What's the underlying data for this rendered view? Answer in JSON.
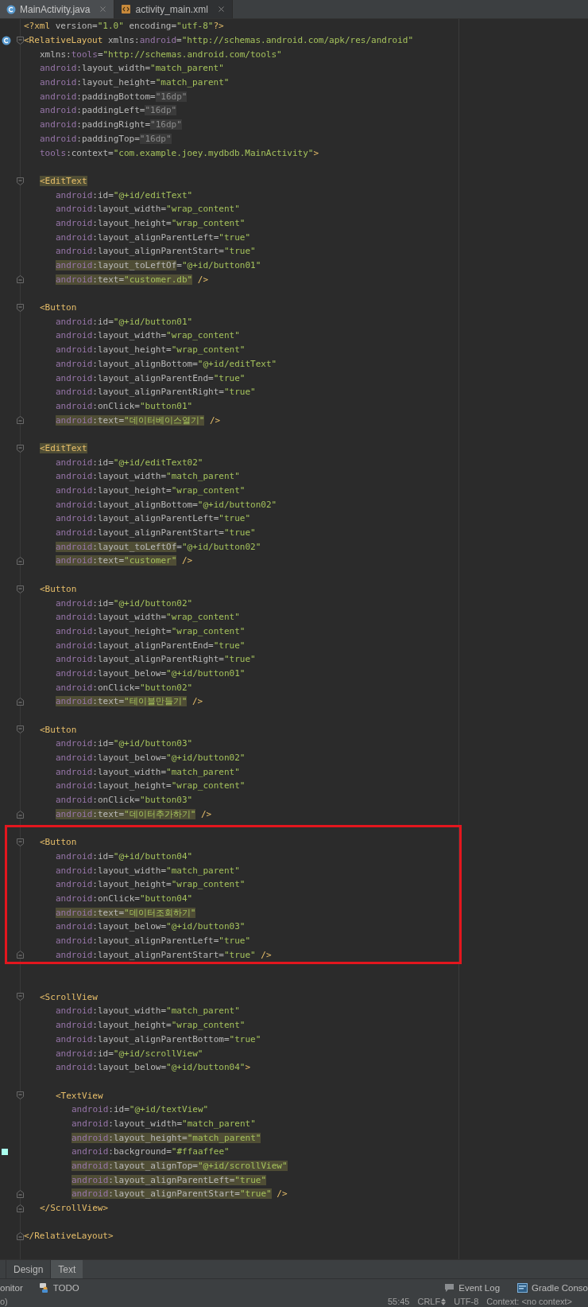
{
  "tabs": [
    {
      "label": "MainActivity.java",
      "kind": "java",
      "selected": false
    },
    {
      "label": "activity_main.xml",
      "kind": "xml",
      "selected": true
    }
  ],
  "code": [
    {
      "kind": "plain",
      "tokens": [
        {
          "t": "<?xml",
          "kind": "tag"
        },
        {
          "t": " version=",
          "kind": "attr"
        },
        {
          "t": "\"1.0\"",
          "kind": "str"
        },
        {
          "t": " encoding=",
          "kind": "attr"
        },
        {
          "t": "\"utf-8\"",
          "kind": "str"
        },
        {
          "t": "?>",
          "kind": "tag"
        }
      ]
    },
    {
      "kind": "class_open",
      "tokens": [
        {
          "t": "<RelativeLayout",
          "kind": "tag"
        },
        {
          "t": " xmlns:",
          "kind": "attr"
        },
        {
          "t": "android",
          "kind": "ns"
        },
        {
          "t": "=",
          "kind": "attr"
        },
        {
          "t": "\"http://schemas.android.com/apk/res/android\"",
          "kind": "str"
        }
      ],
      "children": [
        {
          "kind": "plain",
          "tokens": [
            {
              "t": "xmlns:",
              "kind": "attr"
            },
            {
              "t": "tools",
              "kind": "ns"
            },
            {
              "t": "=",
              "kind": "attr"
            },
            {
              "t": "\"http://schemas.android.com/tools\"",
              "kind": "str"
            }
          ]
        },
        {
          "kind": "plain",
          "tokens": [
            {
              "t": "android",
              "kind": "ns"
            },
            {
              "t": ":layout_width=",
              "kind": "attr"
            },
            {
              "t": "\"match_parent\"",
              "kind": "str"
            }
          ]
        },
        {
          "kind": "plain",
          "tokens": [
            {
              "t": "android",
              "kind": "ns"
            },
            {
              "t": ":layout_height=",
              "kind": "attr"
            },
            {
              "t": "\"match_parent\"",
              "kind": "str"
            }
          ]
        },
        {
          "kind": "plain",
          "tokens": [
            {
              "t": "android",
              "kind": "ns"
            },
            {
              "t": ":paddingBottom=",
              "kind": "attr"
            },
            {
              "t": "\"16dp\"",
              "kind": "dim"
            }
          ]
        },
        {
          "kind": "plain",
          "tokens": [
            {
              "t": "android",
              "kind": "ns"
            },
            {
              "t": ":paddingLeft=",
              "kind": "attr"
            },
            {
              "t": "\"16dp\"",
              "kind": "dim"
            }
          ]
        },
        {
          "kind": "plain",
          "tokens": [
            {
              "t": "android",
              "kind": "ns"
            },
            {
              "t": ":paddingRight=",
              "kind": "attr"
            },
            {
              "t": "\"16dp\"",
              "kind": "dim"
            }
          ]
        },
        {
          "kind": "plain",
          "tokens": [
            {
              "t": "android",
              "kind": "ns"
            },
            {
              "t": ":paddingTop=",
              "kind": "attr"
            },
            {
              "t": "\"16dp\"",
              "kind": "dim"
            }
          ]
        },
        {
          "kind": "plain",
          "tokens": [
            {
              "t": "tools",
              "kind": "ns"
            },
            {
              "t": ":context=",
              "kind": "attr"
            },
            {
              "t": "\"com.example.joey.mydbdb.MainActivity\"",
              "kind": "str"
            },
            {
              "t": ">",
              "kind": "tag"
            }
          ]
        },
        {
          "kind": "blank"
        },
        {
          "kind": "open",
          "tokens": [
            {
              "t": "<EditText",
              "kind": "tag_hl"
            }
          ],
          "children": [
            {
              "kind": "plain",
              "tokens": [
                {
                  "t": "android",
                  "kind": "ns"
                },
                {
                  "t": ":id=",
                  "kind": "attr"
                },
                {
                  "t": "\"@+id/editText\"",
                  "kind": "str"
                }
              ]
            },
            {
              "kind": "plain",
              "tokens": [
                {
                  "t": "android",
                  "kind": "ns"
                },
                {
                  "t": ":layout_width=",
                  "kind": "attr"
                },
                {
                  "t": "\"wrap_content\"",
                  "kind": "str"
                }
              ]
            },
            {
              "kind": "plain",
              "tokens": [
                {
                  "t": "android",
                  "kind": "ns"
                },
                {
                  "t": ":layout_height=",
                  "kind": "attr"
                },
                {
                  "t": "\"wrap_content\"",
                  "kind": "str"
                }
              ]
            },
            {
              "kind": "plain",
              "tokens": [
                {
                  "t": "android",
                  "kind": "ns"
                },
                {
                  "t": ":layout_alignParentLeft=",
                  "kind": "attr"
                },
                {
                  "t": "\"true\"",
                  "kind": "str"
                }
              ]
            },
            {
              "kind": "plain",
              "tokens": [
                {
                  "t": "android",
                  "kind": "ns"
                },
                {
                  "t": ":layout_alignParentStart=",
                  "kind": "attr"
                },
                {
                  "t": "\"true\"",
                  "kind": "str"
                }
              ]
            },
            {
              "kind": "plain",
              "tokens": [
                {
                  "t": "android",
                  "kind": "ns_hl"
                },
                {
                  "t": ":layout_toLeftOf",
                  "kind": "attr_hl"
                },
                {
                  "t": "=",
                  "kind": "attr"
                },
                {
                  "t": "\"@+id/button01\"",
                  "kind": "str"
                }
              ]
            },
            {
              "kind": "close",
              "tokens": [
                {
                  "t": "android",
                  "kind": "ns_hl"
                },
                {
                  "t": ":text=",
                  "kind": "attr_hl"
                },
                {
                  "t": "\"customer.db\"",
                  "kind": "str_hl"
                },
                {
                  "t": " />",
                  "kind": "tag"
                }
              ]
            }
          ]
        },
        {
          "kind": "blank"
        },
        {
          "kind": "open",
          "tokens": [
            {
              "t": "<Button",
              "kind": "tag"
            }
          ],
          "children": [
            {
              "kind": "plain",
              "tokens": [
                {
                  "t": "android",
                  "kind": "ns"
                },
                {
                  "t": ":id=",
                  "kind": "attr"
                },
                {
                  "t": "\"@+id/button01\"",
                  "kind": "str"
                }
              ]
            },
            {
              "kind": "plain",
              "tokens": [
                {
                  "t": "android",
                  "kind": "ns"
                },
                {
                  "t": ":layout_width=",
                  "kind": "attr"
                },
                {
                  "t": "\"wrap_content\"",
                  "kind": "str"
                }
              ]
            },
            {
              "kind": "plain",
              "tokens": [
                {
                  "t": "android",
                  "kind": "ns"
                },
                {
                  "t": ":layout_height=",
                  "kind": "attr"
                },
                {
                  "t": "\"wrap_content\"",
                  "kind": "str"
                }
              ]
            },
            {
              "kind": "plain",
              "tokens": [
                {
                  "t": "android",
                  "kind": "ns"
                },
                {
                  "t": ":layout_alignBottom=",
                  "kind": "attr"
                },
                {
                  "t": "\"@+id/editText\"",
                  "kind": "str"
                }
              ]
            },
            {
              "kind": "plain",
              "tokens": [
                {
                  "t": "android",
                  "kind": "ns"
                },
                {
                  "t": ":layout_alignParentEnd=",
                  "kind": "attr"
                },
                {
                  "t": "\"true\"",
                  "kind": "str"
                }
              ]
            },
            {
              "kind": "plain",
              "tokens": [
                {
                  "t": "android",
                  "kind": "ns"
                },
                {
                  "t": ":layout_alignParentRight=",
                  "kind": "attr"
                },
                {
                  "t": "\"true\"",
                  "kind": "str"
                }
              ]
            },
            {
              "kind": "plain",
              "tokens": [
                {
                  "t": "android",
                  "kind": "ns"
                },
                {
                  "t": ":onClick=",
                  "kind": "attr"
                },
                {
                  "t": "\"button01\"",
                  "kind": "str"
                }
              ]
            },
            {
              "kind": "close",
              "tokens": [
                {
                  "t": "android",
                  "kind": "ns_hl"
                },
                {
                  "t": ":text=",
                  "kind": "attr_hl"
                },
                {
                  "t": "\"데이터베이스열기\"",
                  "kind": "str_hl"
                },
                {
                  "t": " />",
                  "kind": "tag"
                }
              ]
            }
          ]
        },
        {
          "kind": "blank"
        },
        {
          "kind": "open",
          "tokens": [
            {
              "t": "<EditText",
              "kind": "tag_hl"
            }
          ],
          "children": [
            {
              "kind": "plain",
              "tokens": [
                {
                  "t": "android",
                  "kind": "ns"
                },
                {
                  "t": ":id=",
                  "kind": "attr"
                },
                {
                  "t": "\"@+id/editText02\"",
                  "kind": "str"
                }
              ]
            },
            {
              "kind": "plain",
              "tokens": [
                {
                  "t": "android",
                  "kind": "ns"
                },
                {
                  "t": ":layout_width=",
                  "kind": "attr"
                },
                {
                  "t": "\"match_parent\"",
                  "kind": "str"
                }
              ]
            },
            {
              "kind": "plain",
              "tokens": [
                {
                  "t": "android",
                  "kind": "ns"
                },
                {
                  "t": ":layout_height=",
                  "kind": "attr"
                },
                {
                  "t": "\"wrap_content\"",
                  "kind": "str"
                }
              ]
            },
            {
              "kind": "plain",
              "tokens": [
                {
                  "t": "android",
                  "kind": "ns"
                },
                {
                  "t": ":layout_alignBottom=",
                  "kind": "attr"
                },
                {
                  "t": "\"@+id/button02\"",
                  "kind": "str"
                }
              ]
            },
            {
              "kind": "plain",
              "tokens": [
                {
                  "t": "android",
                  "kind": "ns"
                },
                {
                  "t": ":layout_alignParentLeft=",
                  "kind": "attr"
                },
                {
                  "t": "\"true\"",
                  "kind": "str"
                }
              ]
            },
            {
              "kind": "plain",
              "tokens": [
                {
                  "t": "android",
                  "kind": "ns"
                },
                {
                  "t": ":layout_alignParentStart=",
                  "kind": "attr"
                },
                {
                  "t": "\"true\"",
                  "kind": "str"
                }
              ]
            },
            {
              "kind": "plain",
              "tokens": [
                {
                  "t": "android",
                  "kind": "ns_hl"
                },
                {
                  "t": ":layout_toLeftOf",
                  "kind": "attr_hl"
                },
                {
                  "t": "=",
                  "kind": "attr"
                },
                {
                  "t": "\"@+id/button02\"",
                  "kind": "str"
                }
              ]
            },
            {
              "kind": "close",
              "tokens": [
                {
                  "t": "android",
                  "kind": "ns_hl"
                },
                {
                  "t": ":text=",
                  "kind": "attr_hl"
                },
                {
                  "t": "\"customer\"",
                  "kind": "str_hl"
                },
                {
                  "t": " />",
                  "kind": "tag"
                }
              ]
            }
          ]
        },
        {
          "kind": "blank"
        },
        {
          "kind": "open",
          "tokens": [
            {
              "t": "<Button",
              "kind": "tag"
            }
          ],
          "children": [
            {
              "kind": "plain",
              "tokens": [
                {
                  "t": "android",
                  "kind": "ns"
                },
                {
                  "t": ":id=",
                  "kind": "attr"
                },
                {
                  "t": "\"@+id/button02\"",
                  "kind": "str"
                }
              ]
            },
            {
              "kind": "plain",
              "tokens": [
                {
                  "t": "android",
                  "kind": "ns"
                },
                {
                  "t": ":layout_width=",
                  "kind": "attr"
                },
                {
                  "t": "\"wrap_content\"",
                  "kind": "str"
                }
              ]
            },
            {
              "kind": "plain",
              "tokens": [
                {
                  "t": "android",
                  "kind": "ns"
                },
                {
                  "t": ":layout_height=",
                  "kind": "attr"
                },
                {
                  "t": "\"wrap_content\"",
                  "kind": "str"
                }
              ]
            },
            {
              "kind": "plain",
              "tokens": [
                {
                  "t": "android",
                  "kind": "ns"
                },
                {
                  "t": ":layout_alignParentEnd=",
                  "kind": "attr"
                },
                {
                  "t": "\"true\"",
                  "kind": "str"
                }
              ]
            },
            {
              "kind": "plain",
              "tokens": [
                {
                  "t": "android",
                  "kind": "ns"
                },
                {
                  "t": ":layout_alignParentRight=",
                  "kind": "attr"
                },
                {
                  "t": "\"true\"",
                  "kind": "str"
                }
              ]
            },
            {
              "kind": "plain",
              "tokens": [
                {
                  "t": "android",
                  "kind": "ns"
                },
                {
                  "t": ":layout_below=",
                  "kind": "attr"
                },
                {
                  "t": "\"@+id/button01\"",
                  "kind": "str"
                }
              ]
            },
            {
              "kind": "plain",
              "tokens": [
                {
                  "t": "android",
                  "kind": "ns"
                },
                {
                  "t": ":onClick=",
                  "kind": "attr"
                },
                {
                  "t": "\"button02\"",
                  "kind": "str"
                }
              ]
            },
            {
              "kind": "close",
              "tokens": [
                {
                  "t": "android",
                  "kind": "ns_hl"
                },
                {
                  "t": ":text=",
                  "kind": "attr_hl"
                },
                {
                  "t": "\"테이블만들기\"",
                  "kind": "str_hl"
                },
                {
                  "t": " />",
                  "kind": "tag"
                }
              ]
            }
          ]
        },
        {
          "kind": "blank"
        },
        {
          "kind": "open",
          "tokens": [
            {
              "t": "<Button",
              "kind": "tag"
            }
          ],
          "children": [
            {
              "kind": "plain",
              "tokens": [
                {
                  "t": "android",
                  "kind": "ns"
                },
                {
                  "t": ":id=",
                  "kind": "attr"
                },
                {
                  "t": "\"@+id/button03\"",
                  "kind": "str"
                }
              ]
            },
            {
              "kind": "plain",
              "tokens": [
                {
                  "t": "android",
                  "kind": "ns"
                },
                {
                  "t": ":layout_below=",
                  "kind": "attr"
                },
                {
                  "t": "\"@+id/button02\"",
                  "kind": "str"
                }
              ]
            },
            {
              "kind": "plain",
              "tokens": [
                {
                  "t": "android",
                  "kind": "ns"
                },
                {
                  "t": ":layout_width=",
                  "kind": "attr"
                },
                {
                  "t": "\"match_parent\"",
                  "kind": "str"
                }
              ]
            },
            {
              "kind": "plain",
              "tokens": [
                {
                  "t": "android",
                  "kind": "ns"
                },
                {
                  "t": ":layout_height=",
                  "kind": "attr"
                },
                {
                  "t": "\"wrap_content\"",
                  "kind": "str"
                }
              ]
            },
            {
              "kind": "plain",
              "tokens": [
                {
                  "t": "android",
                  "kind": "ns"
                },
                {
                  "t": ":onClick=",
                  "kind": "attr"
                },
                {
                  "t": "\"button03\"",
                  "kind": "str"
                }
              ]
            },
            {
              "kind": "close",
              "tokens": [
                {
                  "t": "android",
                  "kind": "ns_hl"
                },
                {
                  "t": ":text=",
                  "kind": "attr_hl"
                },
                {
                  "t": "\"데이터추가하기\"",
                  "kind": "str_hl"
                },
                {
                  "t": " />",
                  "kind": "tag"
                }
              ]
            }
          ]
        },
        {
          "kind": "blank"
        },
        {
          "kind": "frame",
          "children": [
            {
              "kind": "open",
              "tokens": [
                {
                  "t": "<Button",
                  "kind": "tag"
                }
              ],
              "children": [
                {
                  "kind": "plain",
                  "tokens": [
                    {
                      "t": "android",
                      "kind": "ns"
                    },
                    {
                      "t": ":id=",
                      "kind": "attr"
                    },
                    {
                      "t": "\"@+id/button04\"",
                      "kind": "str"
                    }
                  ]
                },
                {
                  "kind": "plain",
                  "tokens": [
                    {
                      "t": "android",
                      "kind": "ns"
                    },
                    {
                      "t": ":layout_width=",
                      "kind": "attr"
                    },
                    {
                      "t": "\"match_parent\"",
                      "kind": "str"
                    }
                  ]
                },
                {
                  "kind": "plain",
                  "tokens": [
                    {
                      "t": "android",
                      "kind": "ns"
                    },
                    {
                      "t": ":layout_height=",
                      "kind": "attr"
                    },
                    {
                      "t": "\"wrap_content\"",
                      "kind": "str"
                    }
                  ]
                },
                {
                  "kind": "plain",
                  "tokens": [
                    {
                      "t": "android",
                      "kind": "ns"
                    },
                    {
                      "t": ":onClick=",
                      "kind": "attr"
                    },
                    {
                      "t": "\"button04\"",
                      "kind": "str"
                    }
                  ]
                },
                {
                  "kind": "plain",
                  "tokens": [
                    {
                      "t": "android",
                      "kind": "ns_hl"
                    },
                    {
                      "t": ":text=",
                      "kind": "attr_hl"
                    },
                    {
                      "t": "\"데이터조회하기\"",
                      "kind": "str_hl"
                    }
                  ]
                },
                {
                  "kind": "plain",
                  "tokens": [
                    {
                      "t": "android",
                      "kind": "ns"
                    },
                    {
                      "t": ":layout_below=",
                      "kind": "attr"
                    },
                    {
                      "t": "\"@+id/button03\"",
                      "kind": "str"
                    }
                  ]
                },
                {
                  "kind": "plain",
                  "tokens": [
                    {
                      "t": "android",
                      "kind": "ns"
                    },
                    {
                      "t": ":layout_alignParentLeft=",
                      "kind": "attr"
                    },
                    {
                      "t": "\"true\"",
                      "kind": "str"
                    }
                  ]
                },
                {
                  "kind": "close",
                  "tokens": [
                    {
                      "t": "android",
                      "kind": "ns"
                    },
                    {
                      "t": ":layout_alignParentStart=",
                      "kind": "attr"
                    },
                    {
                      "t": "\"true\"",
                      "kind": "str"
                    },
                    {
                      "t": " />",
                      "kind": "tag"
                    }
                  ]
                }
              ]
            }
          ]
        },
        {
          "kind": "blank"
        },
        {
          "kind": "blank"
        },
        {
          "kind": "open",
          "tokens": [
            {
              "t": "<ScrollView",
              "kind": "tag"
            }
          ],
          "children": [
            {
              "kind": "plain",
              "tokens": [
                {
                  "t": "android",
                  "kind": "ns"
                },
                {
                  "t": ":layout_width=",
                  "kind": "attr"
                },
                {
                  "t": "\"match_parent\"",
                  "kind": "str"
                }
              ]
            },
            {
              "kind": "plain",
              "tokens": [
                {
                  "t": "android",
                  "kind": "ns"
                },
                {
                  "t": ":layout_height=",
                  "kind": "attr"
                },
                {
                  "t": "\"wrap_content\"",
                  "kind": "str"
                }
              ]
            },
            {
              "kind": "plain",
              "tokens": [
                {
                  "t": "android",
                  "kind": "ns"
                },
                {
                  "t": ":layout_alignParentBottom=",
                  "kind": "attr"
                },
                {
                  "t": "\"true\"",
                  "kind": "str"
                }
              ]
            },
            {
              "kind": "plain",
              "tokens": [
                {
                  "t": "android",
                  "kind": "ns"
                },
                {
                  "t": ":id=",
                  "kind": "attr"
                },
                {
                  "t": "\"@+id/scrollView\"",
                  "kind": "str"
                }
              ]
            },
            {
              "kind": "plain",
              "tokens": [
                {
                  "t": "android",
                  "kind": "ns"
                },
                {
                  "t": ":layout_below=",
                  "kind": "attr"
                },
                {
                  "t": "\"@+id/button04\"",
                  "kind": "str"
                },
                {
                  "t": ">",
                  "kind": "tag"
                }
              ]
            },
            {
              "kind": "blank"
            },
            {
              "kind": "open",
              "tokens": [
                {
                  "t": "<TextView",
                  "kind": "tag"
                }
              ],
              "children": [
                {
                  "kind": "plain",
                  "tokens": [
                    {
                      "t": "android",
                      "kind": "ns"
                    },
                    {
                      "t": ":id=",
                      "kind": "attr"
                    },
                    {
                      "t": "\"@+id/textView\"",
                      "kind": "str"
                    }
                  ]
                },
                {
                  "kind": "plain",
                  "tokens": [
                    {
                      "t": "android",
                      "kind": "ns"
                    },
                    {
                      "t": ":layout_width=",
                      "kind": "attr"
                    },
                    {
                      "t": "\"match_parent\"",
                      "kind": "str"
                    }
                  ]
                },
                {
                  "kind": "plain",
                  "tokens": [
                    {
                      "t": "android",
                      "kind": "ns_hl"
                    },
                    {
                      "t": ":layout_height=",
                      "kind": "attr_hl"
                    },
                    {
                      "t": "\"match_parent\"",
                      "kind": "str_hl"
                    }
                  ]
                },
                {
                  "kind": "swatch",
                  "tokens": [
                    {
                      "t": "android",
                      "kind": "ns"
                    },
                    {
                      "t": ":background=",
                      "kind": "attr"
                    },
                    {
                      "t": "\"#ffaaffee\"",
                      "kind": "str"
                    }
                  ]
                },
                {
                  "kind": "plain",
                  "tokens": [
                    {
                      "t": "android",
                      "kind": "ns_hl"
                    },
                    {
                      "t": ":layout_alignTop=",
                      "kind": "attr_hl"
                    },
                    {
                      "t": "\"@+id/scrollView\"",
                      "kind": "str_hl"
                    }
                  ]
                },
                {
                  "kind": "plain",
                  "tokens": [
                    {
                      "t": "android",
                      "kind": "ns_hl"
                    },
                    {
                      "t": ":layout_alignParentLeft=",
                      "kind": "attr_hl"
                    },
                    {
                      "t": "\"true\"",
                      "kind": "str_hl"
                    }
                  ]
                },
                {
                  "kind": "close",
                  "tokens": [
                    {
                      "t": "android",
                      "kind": "ns_hl"
                    },
                    {
                      "t": ":layout_alignParentStart=",
                      "kind": "attr_hl"
                    },
                    {
                      "t": "\"true\"",
                      "kind": "str_hl"
                    },
                    {
                      "t": " />",
                      "kind": "tag"
                    }
                  ]
                }
              ]
            }
          ]
        },
        {
          "kind": "close",
          "tokens": [
            {
              "t": "</ScrollView>",
              "kind": "tag"
            }
          ]
        }
      ]
    },
    {
      "kind": "blank"
    },
    {
      "kind": "close",
      "tokens": [
        {
          "t": "</RelativeLayout>",
          "kind": "tag"
        }
      ]
    }
  ],
  "editor_tabs": [
    {
      "label": "Design",
      "selected": false
    },
    {
      "label": "Text",
      "selected": true
    }
  ],
  "tool_windows": {
    "left": [
      {
        "label": "onitor",
        "kind": "plain"
      },
      {
        "label": "TODO",
        "kind": "todo"
      }
    ],
    "right": [
      {
        "label": "Event Log",
        "kind": "event_log"
      },
      {
        "label": "Gradle Conso",
        "kind": "gradle"
      }
    ]
  },
  "status_bar": {
    "left": "o)",
    "items": [
      {
        "text": "55:45",
        "kind": "plain"
      },
      {
        "text": "CRLF",
        "kind": "menu"
      },
      {
        "text": "UTF-8",
        "kind": "plain"
      },
      {
        "text": "Context: <no context>",
        "kind": "plain"
      }
    ]
  }
}
